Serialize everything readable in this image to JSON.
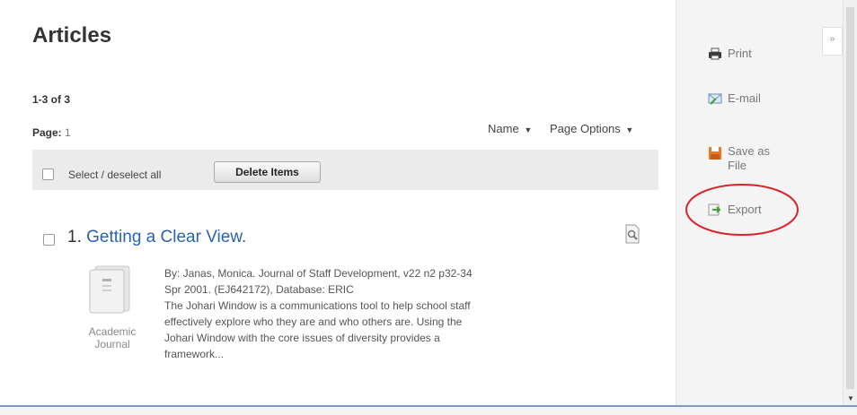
{
  "main": {
    "title": "Articles",
    "result_count": "1-3 of 3",
    "page_label": "Page:",
    "page_number": "1",
    "sort_label": "Name",
    "page_options_label": "Page Options"
  },
  "toolbar": {
    "select_all_label": "Select / deselect all",
    "delete_label": "Delete Items"
  },
  "results": [
    {
      "index": "1.",
      "title": "Getting a Clear View.",
      "pub_type_line1": "Academic",
      "pub_type_line2": "Journal",
      "citation_line1": "By: Janas, Monica. Journal of Staff Development, v22 n2 p32-34",
      "citation_line2": "Spr 2001. (EJ642172), Database: ERIC",
      "abstract_line1": "The Johari Window is a communications tool to help school staff",
      "abstract_line2": "effectively explore who they are and who others are. Using the",
      "abstract_line3": "Johari Window with the core issues of diversity provides a",
      "abstract_line4": "framework..."
    }
  ],
  "sidebar": {
    "collapse_label": "»",
    "items": [
      {
        "label": "Print",
        "icon": "printer-icon"
      },
      {
        "label": "E-mail",
        "icon": "email-icon"
      },
      {
        "label_line1": "Save as",
        "label_line2": "File",
        "icon": "save-icon"
      },
      {
        "label": "Export",
        "icon": "export-icon"
      }
    ]
  },
  "colors": {
    "link": "#2a62b0",
    "annotation": "#d9232a",
    "toolbar_bg": "#ebebeb",
    "sidebar_bg": "#f4f4f4"
  }
}
